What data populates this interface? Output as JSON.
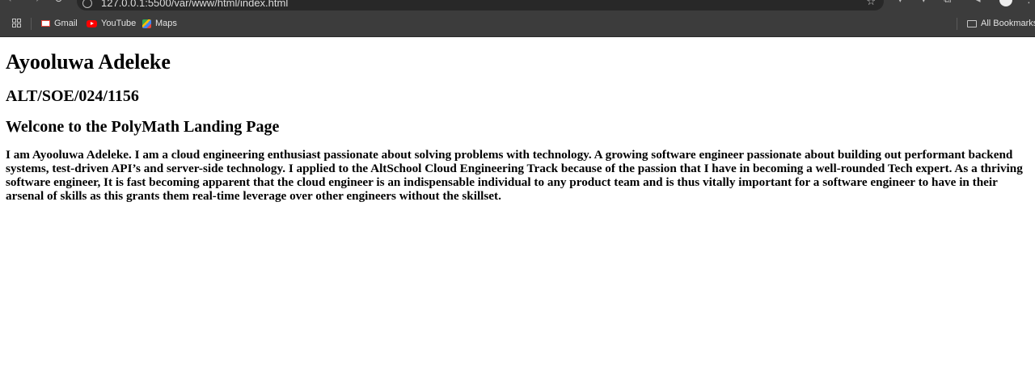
{
  "browser": {
    "url": "127.0.0.1:5500/var/www/html/index.html",
    "bookmarks": [
      {
        "label": "Gmail",
        "icon": "gmail-icon"
      },
      {
        "label": "YouTube",
        "icon": "youtube-icon"
      },
      {
        "label": "Maps",
        "icon": "maps-icon"
      }
    ],
    "all_bookmarks_label": "All Bookmarks"
  },
  "page": {
    "name": "Ayooluwa Adeleke",
    "reg_number": "ALT/SOE/024/1156",
    "welcome": "Welcone to the PolyMath Landing Page",
    "bio": "I am Ayooluwa Adeleke. I am a cloud engineering enthusiast passionate about solving problems with technology. A growing software engineer passionate about building out performant backend systems, test-driven API’s and server-side technology. I applied to the AltSchool Cloud Engineering Track because of the passion that I have in becoming a well-rounded Tech expert. As a thriving software engineer, It is fast becoming apparent that the cloud engineer is an indispensable individual to any product team and is thus vitally important for a software engineer to have in their arsenal of skills as this grants them real-time leverage over other engineers without the skillset."
  },
  "colors": {
    "chrome": "#3c3c3c",
    "omnibox": "#282828",
    "page_background": "#ffffff"
  }
}
